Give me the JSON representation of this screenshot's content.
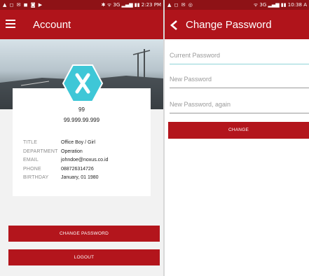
{
  "left": {
    "status": {
      "icons": "▲ ◻ ✉ ◼ ◙ ▶",
      "right": "✱ ᯤ 3G ▂▄▆ ▮▮ 2:23 PM"
    },
    "appbar": {
      "title": "Account"
    },
    "profile": {
      "name": "99",
      "id": "99.999.99.999"
    },
    "info": [
      {
        "label": "TITLE",
        "value": "Office Boy / Girl"
      },
      {
        "label": "DEPARTMENT",
        "value": "Operation"
      },
      {
        "label": "EMAIL",
        "value": "johndoe@noxus.co.id"
      },
      {
        "label": "PHONE",
        "value": "088726314726"
      },
      {
        "label": "BIRTHDAY",
        "value": "January, 01 1980"
      }
    ],
    "buttons": {
      "change_password": "CHANGE PASSWORD",
      "logout": "LOGOUT"
    }
  },
  "right": {
    "status": {
      "icons": "▲ ◻ ✉ ◎",
      "right": "ᯤ 3G ▂▄▆ ▮▮ 10:38 A"
    },
    "appbar": {
      "title": "Change Password"
    },
    "fields": {
      "current": "Current Password",
      "new": "New Password",
      "again": "New Password, again"
    },
    "buttons": {
      "change": "CHANGE"
    }
  },
  "colors": {
    "appbar": "#b0141b",
    "statusbar": "#8e1216",
    "button": "#b3151c",
    "logo": "#3ec7d7"
  }
}
